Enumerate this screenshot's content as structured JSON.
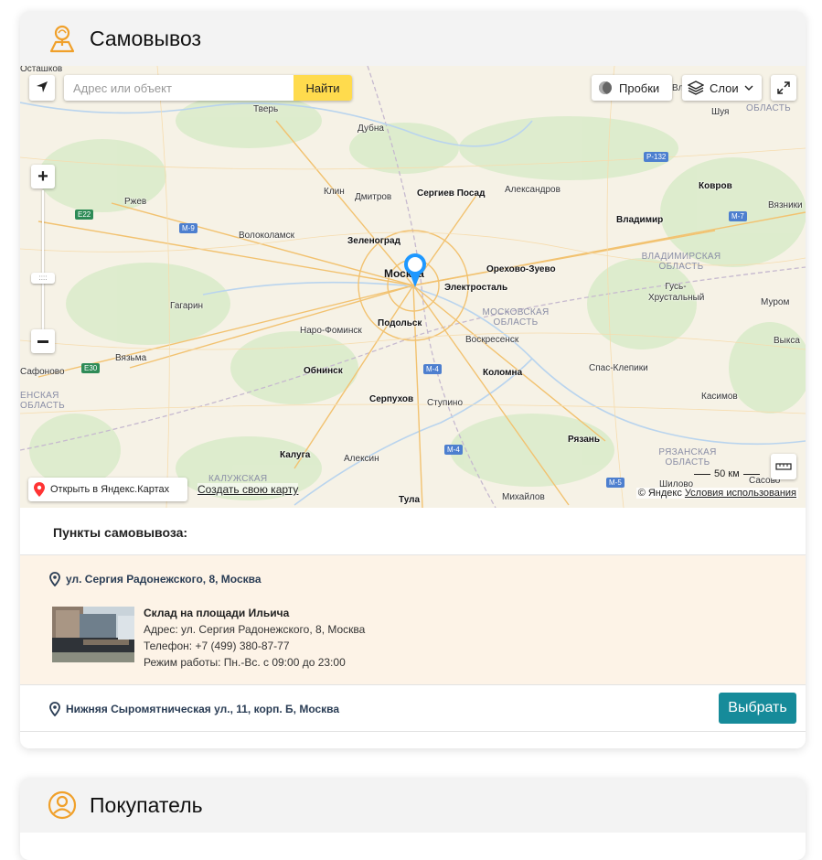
{
  "pickup": {
    "title": "Самовывоз",
    "points_title": "Пункты самовывоза:"
  },
  "map": {
    "search_placeholder": "Адрес или объект",
    "find_label": "Найти",
    "traffic_label": "Пробки",
    "layers_label": "Слои",
    "open_yandex_label": "Открыть в Яндекс.Картах",
    "create_map_label": "Создать свою карту",
    "copyright": "© Яндекс",
    "terms_label": "Условия использования",
    "scale_label": "50 км",
    "cities": [
      "Осташков",
      "Тверь",
      "Дубна",
      "Шуя",
      "Ржев",
      "Клин",
      "Дмитров",
      "Сергиев Посад",
      "Александров",
      "Ковров",
      "Вязники",
      "Волоколамск",
      "Зеленоград",
      "Владимир",
      "Москва",
      "Орехово-Зуево",
      "Электросталь",
      "Гагарин",
      "Гусь-Хрустальный",
      "Муром",
      "Наро-Фоминск",
      "Подольск",
      "Вязьма",
      "Воскресенск",
      "Выкса",
      "Сафоново",
      "Обнинск",
      "Коломна",
      "Спас-Клепики",
      "Серпухов",
      "Ступино",
      "Касимов",
      "Рязань",
      "Калуга",
      "Алексин",
      "Сасово",
      "Шилово",
      "Тула",
      "Михайлов"
    ],
    "regions": [
      "МОСКОВСКАЯ ОБЛАСТЬ",
      "ВЛАДИМИРСКАЯ ОБЛАСТЬ",
      "РЯЗАНСКАЯ ОБЛАСТЬ",
      "КАЛУЖСКАЯ",
      "ЕНСКАЯ ОБЛАСТЬ",
      "ОБЛАСТЬ"
    ],
    "roads": [
      "E22",
      "M-9",
      "M-7",
      "P-132",
      "E30",
      "M-4",
      "M-5"
    ],
    "cut_labels": [
      "Вла"
    ]
  },
  "points": [
    {
      "address": "ул. Сергия Радонежского, 8, Москва",
      "name": "Склад на площади Ильича",
      "addr_line": "Адрес: ул. Сергия Радонежского, 8, Москва",
      "phone_line": "Телефон: +7 (499) 380-87-77",
      "hours_line": "Режим работы: Пн.-Вс. с 09:00 до 23:00"
    },
    {
      "address": "Нижняя Сыромятническая ул., 11, корп. Б, Москва",
      "choose_label": "Выбрать"
    }
  ],
  "buyer": {
    "title": "Покупатель"
  },
  "colors": {
    "accent_orange": "#f0a02a",
    "button_teal": "#168b9a",
    "find_yellow": "#ffdb4d",
    "active_row": "#fdf3e7"
  }
}
